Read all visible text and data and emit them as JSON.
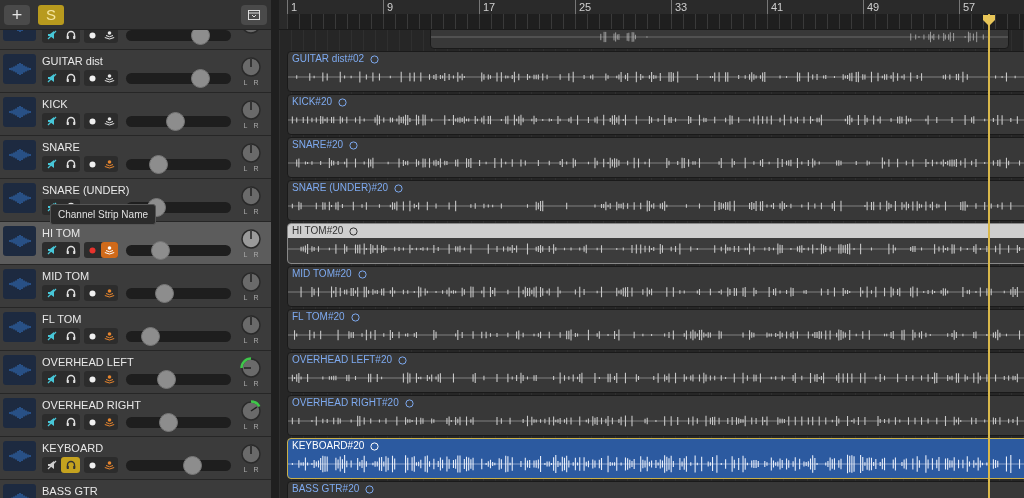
{
  "toolbar": {
    "add_label": "+",
    "solo_label": "S"
  },
  "ruler": {
    "bars": [
      "1",
      "9",
      "17",
      "25",
      "33",
      "41",
      "49",
      "57"
    ]
  },
  "tracks": [
    {
      "selected": false,
      "muted": false,
      "solo": false,
      "record": false,
      "monitoring": false,
      "level": 0.71,
      "region": {
        "kind": "partial",
        "selected": false
      }
    },
    {
      "name": "GUITAR dist",
      "selected": false,
      "muted": false,
      "solo": false,
      "record": false,
      "monitoring": false,
      "level": 0.71,
      "pan_left": false,
      "pan_right": false,
      "knob_labels": [
        "L",
        "R"
      ],
      "region": {
        "label": "GUITAR dist#02",
        "kind": "full",
        "selected": false
      }
    },
    {
      "name": "KICK",
      "selected": false,
      "muted": false,
      "solo": false,
      "record": false,
      "monitoring": false,
      "level": 0.47,
      "pan_left": false,
      "pan_right": false,
      "knob_labels": [
        "L",
        "R"
      ],
      "region": {
        "label": "KICK#20",
        "kind": "full",
        "selected": false
      }
    },
    {
      "name": "SNARE",
      "selected": false,
      "muted": false,
      "solo": false,
      "record": false,
      "monitoring": true,
      "level": 0.31,
      "pan_left": false,
      "pan_right": false,
      "knob_labels": [
        "L",
        "R"
      ],
      "region": {
        "label": "SNARE#20",
        "kind": "full",
        "selected": false
      }
    },
    {
      "name": "SNARE (UNDER)",
      "selected": false,
      "muted": false,
      "solo": false,
      "level": 0.29,
      "pan_left": false,
      "pan_right": false,
      "knob_labels": [
        "L",
        "R"
      ],
      "region": {
        "label": "SNARE (UNDER)#20",
        "kind": "full",
        "selected": false
      }
    },
    {
      "name": "HI TOM",
      "selected": true,
      "muted": false,
      "solo": false,
      "record": true,
      "monitoring": true,
      "level": 0.33,
      "pan_left": false,
      "pan_right": false,
      "knob_labels": [
        "L",
        "R"
      ],
      "region": {
        "label": "HI TOM#20",
        "kind": "full",
        "selected": false
      }
    },
    {
      "name": "MID TOM",
      "selected": false,
      "muted": false,
      "solo": false,
      "record": false,
      "monitoring": true,
      "level": 0.37,
      "pan_left": false,
      "pan_right": false,
      "knob_labels": [
        "L",
        "R"
      ],
      "region": {
        "label": "MID TOM#20",
        "kind": "full",
        "selected": false
      }
    },
    {
      "name": "FL TOM",
      "selected": false,
      "muted": false,
      "solo": false,
      "record": false,
      "monitoring": true,
      "level": 0.23,
      "pan_left": false,
      "pan_right": false,
      "knob_labels": [
        "L",
        "R"
      ],
      "region": {
        "label": "FL TOM#20",
        "kind": "full",
        "selected": false
      }
    },
    {
      "name": "OVERHEAD LEFT",
      "selected": false,
      "muted": false,
      "solo": false,
      "record": false,
      "monitoring": true,
      "level": 0.39,
      "pan_left": true,
      "pan_right": false,
      "knob_labels": [
        "L",
        "R"
      ],
      "region": {
        "label": "OVERHEAD LEFT#20",
        "kind": "full",
        "selected": false
      }
    },
    {
      "name": "OVERHEAD RIGHT",
      "selected": false,
      "muted": false,
      "solo": false,
      "record": false,
      "monitoring": true,
      "level": 0.4,
      "pan_left": false,
      "pan_right": true,
      "knob_labels": [
        "L",
        "R"
      ],
      "region": {
        "label": "OVERHEAD RIGHT#20",
        "kind": "full",
        "selected": false
      }
    },
    {
      "name": "KEYBOARD",
      "selected": false,
      "muted": true,
      "solo": true,
      "record": false,
      "monitoring": true,
      "level": 0.63,
      "pan_left": false,
      "pan_right": false,
      "knob_labels": [
        "L",
        "R"
      ],
      "region": {
        "label": "KEYBOARD#20",
        "kind": "full",
        "selected": true
      }
    },
    {
      "name": "BASS GTR",
      "selected": false,
      "region": {
        "label": "BASS GTR#20",
        "kind": "full",
        "selected": false
      }
    }
  ],
  "tooltip": "Channel Strip Name"
}
